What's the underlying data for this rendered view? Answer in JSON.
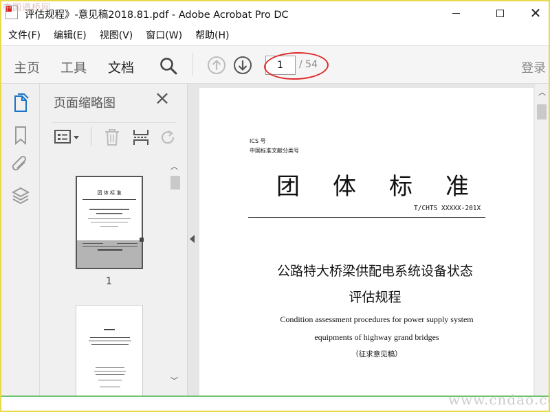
{
  "watermark": {
    "top_left": "中国道桥网",
    "bottom_right": "www.cndao.com"
  },
  "window": {
    "title": "评估规程》-意见稿2018.81.pdf - Adobe Acrobat Pro DC"
  },
  "menu": [
    "文件(F)",
    "编辑(E)",
    "视图(V)",
    "窗口(W)",
    "帮助(H)"
  ],
  "toolbar": {
    "tabs": [
      "主页",
      "工具",
      "文档"
    ],
    "active_tab": "文档",
    "page_current": "1",
    "page_total": "/ 54",
    "login_label": "登录"
  },
  "thumbnails": {
    "title": "页面缩略图",
    "page_numbers": [
      "1"
    ],
    "thumb1_title": "团  体  标  准"
  },
  "document": {
    "ics": "ICS 号",
    "classification": "中国标准文献分类号",
    "main_title": "团体标准",
    "std_code": "T/CHTS XXXXX-201X",
    "cn_title_line1": "公路特大桥梁供配电系统设备状态",
    "cn_title_line2": "评估规程",
    "en_title_line1": "Condition assessment procedures for power supply system",
    "en_title_line2": "equipments of highway grand bridges",
    "draft_note": "（征求意见稿）"
  },
  "colors": {
    "annotation_ellipse": "#e02a2a",
    "watermark": "#cbcbcb",
    "frame": "#e8d84a"
  },
  "icons": [
    "acrobat-document-icon",
    "search-icon",
    "page-up-icon",
    "page-down-icon",
    "pages-icon",
    "bookmark-icon",
    "attachment-icon",
    "layers-icon",
    "close-icon",
    "thumbnail-options-icon",
    "delete-page-icon",
    "insert-page-icon",
    "rotate-page-icon"
  ]
}
